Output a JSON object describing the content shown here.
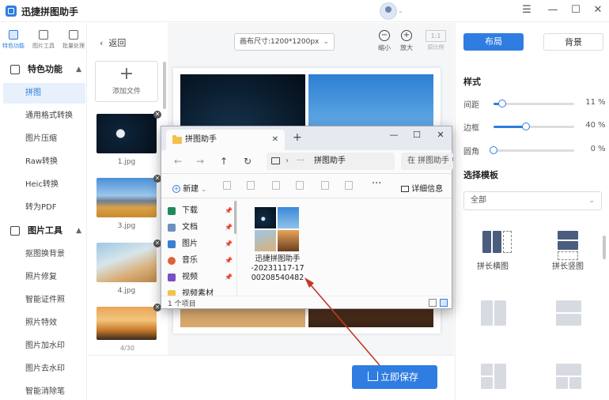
{
  "app": {
    "title": "迅捷拼图助手"
  },
  "rail": {
    "tabs": [
      {
        "label": "特色功能"
      },
      {
        "label": "图片工具"
      },
      {
        "label": "批量处理"
      }
    ]
  },
  "sidebar": {
    "section1": "特色功能",
    "items1": [
      {
        "label": "拼图"
      },
      {
        "label": "通用格式转换"
      },
      {
        "label": "图片压缩"
      },
      {
        "label": "Raw转换"
      },
      {
        "label": "Heic转换"
      },
      {
        "label": "转为PDF"
      }
    ],
    "section2": "图片工具",
    "items2": [
      {
        "label": "抠图换背景"
      },
      {
        "label": "照片修复"
      },
      {
        "label": "智能证件照"
      },
      {
        "label": "照片特效"
      },
      {
        "label": "图片加水印"
      },
      {
        "label": "图片去水印"
      },
      {
        "label": "智能消除笔"
      }
    ]
  },
  "thumbs": {
    "add_label": "添加文件",
    "files": [
      {
        "name": "1.jpg"
      },
      {
        "name": "3.jpg"
      },
      {
        "name": "4.jpg"
      }
    ],
    "page_count": "4/30"
  },
  "canvas": {
    "back_label": "返回",
    "size_label": "画布尺寸:1200*1200px",
    "zoom_out": "缩小",
    "zoom_in": "放大",
    "ratio_value": "1:1",
    "ratio_label": "原比例"
  },
  "save_label": "立即保存",
  "panel": {
    "tab_layout": "布局",
    "tab_background": "背景",
    "style_title": "样式",
    "sliders": [
      {
        "label": "间距",
        "value": "11",
        "unit": "%",
        "fraction": 0.11
      },
      {
        "label": "边框",
        "value": "40",
        "unit": "%",
        "fraction": 0.4
      },
      {
        "label": "圆角",
        "value": "0",
        "unit": "%",
        "fraction": 0.0
      }
    ],
    "template_title": "选择模板",
    "template_select": "全部",
    "templates": [
      {
        "label": "拼长横图"
      },
      {
        "label": "拼长竖图"
      }
    ]
  },
  "explorer": {
    "tab_title": "拼图助手",
    "address": "拼图助手",
    "search_placeholder": "在 拼图助手 中搜索",
    "new_label": "新建",
    "details_label": "详细信息",
    "quick_access": [
      {
        "label": "下载"
      },
      {
        "label": "文档"
      },
      {
        "label": "图片"
      },
      {
        "label": "音乐"
      },
      {
        "label": "视频"
      },
      {
        "label": "视频素材"
      }
    ],
    "file": {
      "name_line1": "迅捷拼图助手",
      "name_line2": "-20231117-17",
      "name_line3": "00208540482"
    },
    "status": "1 个项目"
  },
  "colors": {
    "accent": "#2f7de1",
    "arrow": "#c0392b"
  }
}
